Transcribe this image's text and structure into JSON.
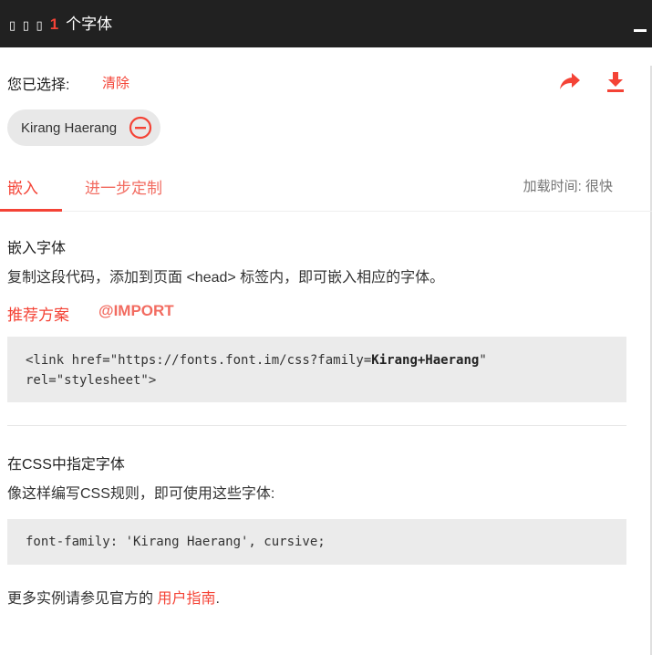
{
  "header": {
    "prefix": "▯ ▯ ▯",
    "count": "1",
    "suffix": "个字体"
  },
  "selection": {
    "label": "您已选择:",
    "clear": "清除",
    "fonts": [
      {
        "name": "Kirang Haerang"
      }
    ]
  },
  "tabs": {
    "embed": "嵌入",
    "customize": "进一步定制",
    "load_time": "加载时间: 很快"
  },
  "embed_section": {
    "heading": "嵌入字体",
    "description": "复制这段代码，添加到页面 <head> 标签内，即可嵌入相应的字体。",
    "option_standard": "推荐方案",
    "option_import": "@IMPORT",
    "code_prefix": "<link href=\"https://fonts.font.im/css?family=",
    "code_family": "Kirang+Haerang",
    "code_suffix": "\" rel=\"stylesheet\">"
  },
  "css_section": {
    "heading": "在CSS中指定字体",
    "description": "像这样编写CSS规则，即可使用这些字体:",
    "code": "font-family: 'Kirang Haerang', cursive;"
  },
  "footer": {
    "text": "更多实例请参见官方的 ",
    "link": "用户指南",
    "end": "."
  },
  "colors": {
    "accent": "#f44336",
    "header_bg": "#212121",
    "code_bg": "#ebebeb"
  },
  "icons": {
    "share": "share-arrow-icon",
    "download": "download-icon",
    "remove": "remove-circle-icon"
  }
}
